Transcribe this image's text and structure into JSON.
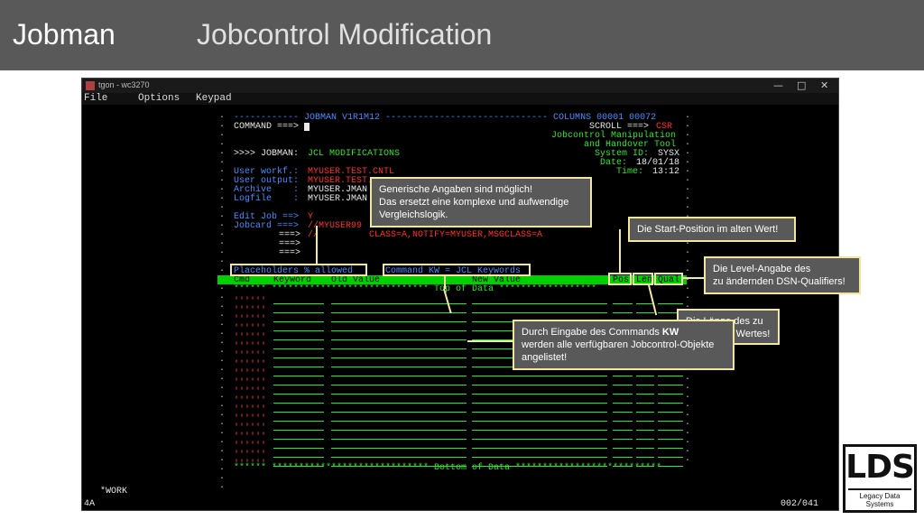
{
  "header": {
    "left": "Jobman",
    "title": "Jobcontrol Modification"
  },
  "window": {
    "title": "tgon - wc3270",
    "menu": [
      "File",
      "Options",
      "Keypad"
    ],
    "controls": {
      "minimize": "—",
      "maximize": "□",
      "close": "✕"
    }
  },
  "terminal": {
    "banner": "------------ JOBMAN V1R1M12 ------------------------------ COLUMNS 00001 00072",
    "command_label": "COMMAND ===>",
    "scroll_label": "SCROLL ===>",
    "scroll_value": "CSR",
    "tool_line1": "Jobcontrol Manipulation",
    "tool_line2": "and Handover Tool",
    "sysid_label": "System ID:",
    "sysid_value": "SYSX",
    "date_label": "Date:",
    "date_value": "18/01/18",
    "time_label": "Time:",
    "time_value": "13:12",
    "prompt": ">>>> JOBMAN:",
    "mode": "JCL MODIFICATIONS",
    "userworkf_label": "User workf.:",
    "userworkf_value": "MYUSER.TEST.CNTL",
    "useroutput_label": "User output:",
    "useroutput_value": "MYUSER.TEST.",
    "archive_label": "Archive    :",
    "archive_value": "MYUSER.JMAN",
    "logfile_label": "Logfile    :",
    "logfile_value": "MYUSER.JMAN",
    "editjob_label": "Edit Job ==>",
    "editjob_value": "Y",
    "jobcard_label": "Jobcard ===>",
    "jobcard_value": "//MYUSER99",
    "jc2_label": "===>",
    "jc2_value": "//",
    "jc2_params": "CLASS=A,NOTIFY=MYUSER,MSGCLASS=A",
    "jc3_label": "===>",
    "jc4_label": "===>",
    "placeholders": "Placeholders % allowed",
    "command_kw": "Command KW = JCL Keywords",
    "col_cmd": "Cmd",
    "col_keyword": "Keyword",
    "col_oldvalue": "Old Value",
    "col_newvalue": "New Value",
    "col_pos": "Pos",
    "col_len": "Len",
    "col_qual": "Qual",
    "top_of_data": "****** ***************************** Top of Data ******************",
    "row_prefix": "''''''",
    "bottom_of_data": "****** ***************************** Bottom of Data ***************************"
  },
  "status": {
    "mode": "4A",
    "work": "*WORK",
    "position": "002/041"
  },
  "callouts": {
    "generic": {
      "line1": "Generische Angaben sind möglich!",
      "line2": "Das ersetzt eine komplexe und aufwendige",
      "line3": "Vergleichslogik."
    },
    "start_pos": "Die Start-Position im alten Wert!",
    "level": {
      "line1": "Die Level-Angabe des",
      "line2": "zu ändernden DSN-Qualifiers!"
    },
    "partial": {
      "line1": "Die Länge des zu",
      "line2": "ändernden Wertes!"
    },
    "kw": {
      "pre": "Durch Eingabe des Commands ",
      "bold": "KW",
      "line2": "werden alle verfügbaren Jobcontrol-Objekte",
      "line3": "angelistet!"
    }
  },
  "logo": {
    "main": "LDS",
    "sub": "Legacy Data Systems"
  }
}
